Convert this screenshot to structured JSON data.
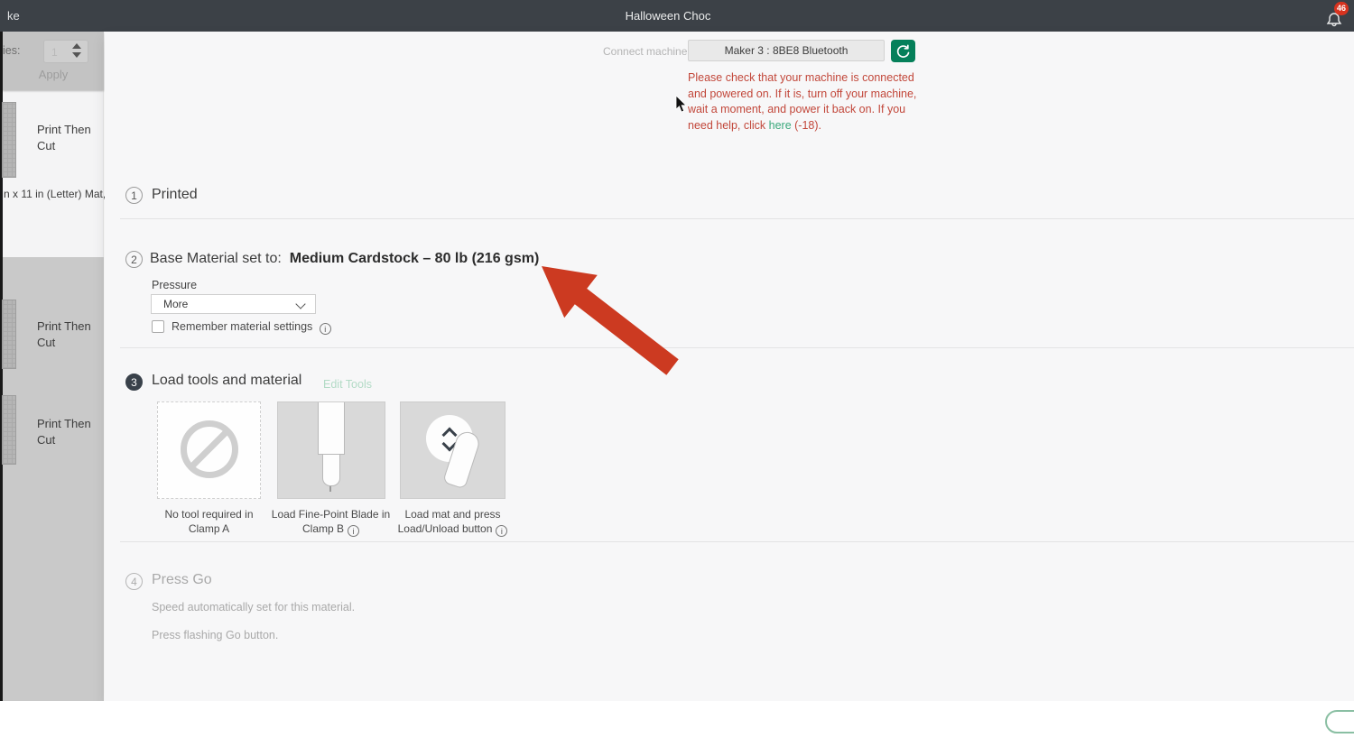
{
  "top_bar": {
    "left_label": "ke",
    "title": "Halloween Choc",
    "notification_count": "46"
  },
  "sidebar": {
    "copies_label": "ies:",
    "copies_value": "1",
    "apply_label": "Apply",
    "items": [
      {
        "label": "Print Then Cut",
        "sublabel": "n x 11 in (Letter) Mat,"
      },
      {
        "label": "Print Then Cut"
      },
      {
        "label": "Print Then Cut"
      }
    ]
  },
  "connect": {
    "label": "Connect machine",
    "machine_value": "Maker 3 : 8BE8 Bluetooth",
    "error_before": "Please check that your machine is connected and powered on. If it is, turn off your machine, wait a moment, and power it back on. If you need help, click ",
    "error_link": "here",
    "error_after": " (-18)."
  },
  "steps": {
    "step1": {
      "number": "1",
      "title": "Printed"
    },
    "step2": {
      "number": "2",
      "title": "Base Material set to:",
      "material": "Medium Cardstock – 80 lb (216 gsm)",
      "pressure_label": "Pressure",
      "pressure_value": "More",
      "remember_label": "Remember material settings"
    },
    "step3": {
      "number": "3",
      "title": "Load tools and material",
      "edit_tools_label": "Edit Tools",
      "tools": [
        {
          "line1": "No tool required in",
          "line2": "Clamp A"
        },
        {
          "line1": "Load Fine-Point Blade in",
          "line2": "Clamp B"
        },
        {
          "line1": "Load mat and press",
          "line2": "Load/Unload button"
        }
      ]
    },
    "step4": {
      "number": "4",
      "title": "Press Go",
      "line1": "Speed automatically set for this material.",
      "line2": "Press flashing Go button."
    }
  },
  "icons": {
    "bell": "bell-outline",
    "refresh": "counterclockwise-arrow",
    "info_glyph": "i",
    "chevron_down": "css-chevron",
    "no_tool": "prohibition-circle",
    "colors": {
      "topbar": "#3c4147",
      "badge_red": "#d7331f",
      "error_red": "#c2473a",
      "link_green": "#3aa87b",
      "button_green": "#05805a",
      "edit_tools_green": "#b3dbc6",
      "arrow_red": "#cc3a21"
    }
  }
}
